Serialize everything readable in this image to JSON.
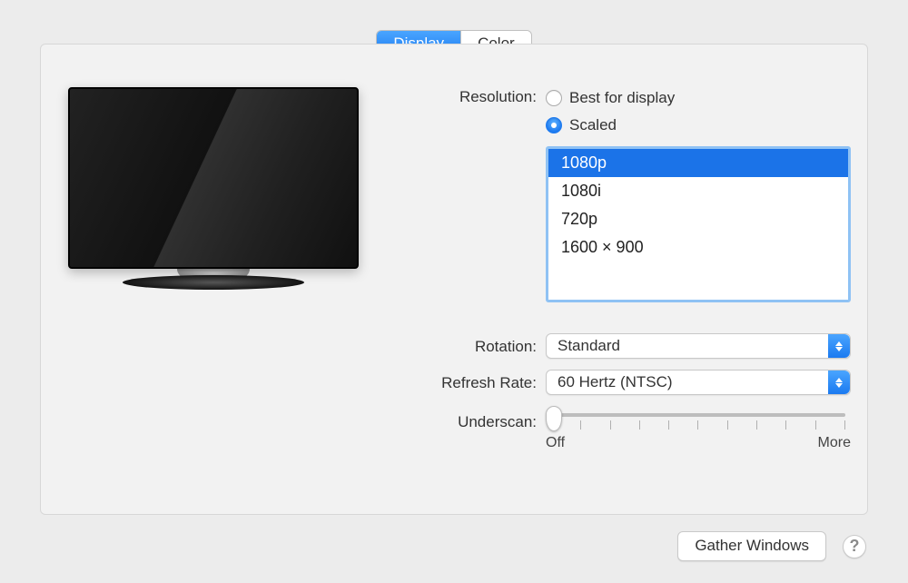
{
  "tabs": {
    "display": "Display",
    "color": "Color",
    "active": "display"
  },
  "labels": {
    "resolution": "Resolution:",
    "rotation": "Rotation:",
    "refresh": "Refresh Rate:",
    "underscan": "Underscan:"
  },
  "resolution": {
    "best_label": "Best for display",
    "scaled_label": "Scaled",
    "selected": "scaled",
    "options": [
      "1080p",
      "1080i",
      "720p",
      "1600 × 900"
    ],
    "option_selected_index": 0
  },
  "rotation": {
    "value": "Standard"
  },
  "refresh": {
    "value": "60 Hertz (NTSC)"
  },
  "underscan": {
    "off_label": "Off",
    "more_label": "More",
    "position": 0
  },
  "buttons": {
    "gather": "Gather Windows"
  }
}
